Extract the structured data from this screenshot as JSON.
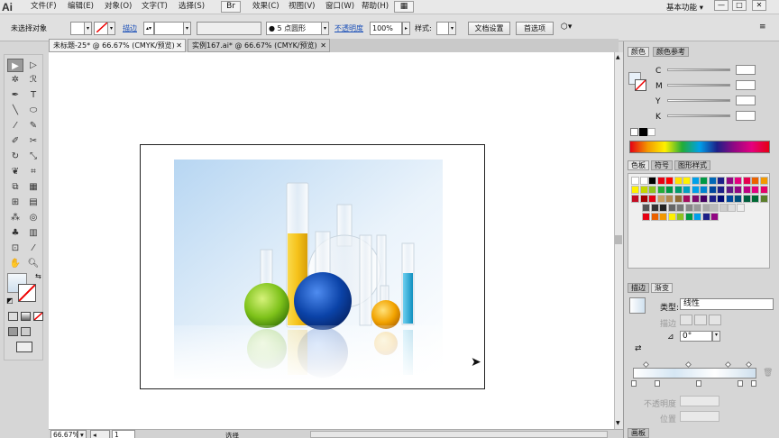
{
  "app": {
    "logo": "Ai"
  },
  "menubar": {
    "items": [
      "文件(F)",
      "编辑(E)",
      "对象(O)",
      "文字(T)",
      "选择(S)",
      "效果(C)",
      "视图(V)",
      "窗口(W)",
      "帮助(H)"
    ],
    "bridge_label": "Br",
    "workspace": "基本功能 ▾",
    "win_minimize": "—",
    "win_maximize": "□",
    "win_close": "✕"
  },
  "control": {
    "no_selection": "未选择对象",
    "stroke_label": "描边",
    "brush_value": "● 5 点圆形",
    "opacity_label": "不透明度",
    "opacity_value": "100%",
    "style_label": "样式:",
    "doc_setup_button": "文档设置",
    "preferences_button": "首选项"
  },
  "tabs": [
    {
      "label": "未标题-25* @ 66.67% (CMYK/预览)",
      "close": "✕",
      "active": true
    },
    {
      "label": "实例167.ai* @ 66.67% (CMYK/预览)",
      "close": "✕",
      "active": false
    }
  ],
  "status": {
    "zoom": "66.67%",
    "page": "1",
    "mode": "选择"
  },
  "panels": {
    "color": {
      "tab_color": "颜色",
      "tab_color_guide": "颜色参考",
      "channels": [
        "C",
        "M",
        "Y",
        "K"
      ]
    },
    "swatches": {
      "tab_swatches": "色板",
      "tab_symbols": "符号",
      "tab_graphic_styles": "图形样式",
      "colors_row1": [
        "#ffffff",
        "#ffffff",
        "#000000",
        "#e60012",
        "#ff0000",
        "#ffe100",
        "#fff100",
        "#00a0e9",
        "#009944",
        "#0068b7",
        "#1d2088",
        "#920783",
        "#e4007f",
        "#e5004f",
        "#eb6100",
        "#f39800"
      ],
      "colors_row2": [
        "#fff100",
        "#c3d600",
        "#8fc31f",
        "#22ac38",
        "#009944",
        "#009b6b",
        "#00a0c1",
        "#00a0e9",
        "#0086d1",
        "#00479d",
        "#1d2088",
        "#601986",
        "#920783",
        "#be0081",
        "#e4007f",
        "#e5006a"
      ],
      "colors_row3": [
        "#c30d23",
        "#a40000",
        "#e60012",
        "#c9a063",
        "#b28850",
        "#8f6a34",
        "#a40b5d",
        "#7e0c6e",
        "#440062",
        "#1d2088",
        "#000b76",
        "#00479d",
        "#004e7a",
        "#005e3c",
        "#006934",
        "#5b7e2b"
      ],
      "colors_row4": [
        "#555555",
        "#333333",
        "#222222",
        "#666666",
        "#777777",
        "#888888",
        "#999999",
        "#aaaaaa",
        "#bbbbbb",
        "#cccccc",
        "#dddddd",
        "#eeeeee"
      ],
      "colors_row5": [
        "#e60012",
        "#eb6100",
        "#f39800",
        "#fff100",
        "#8fc31f",
        "#009944",
        "#00a0e9",
        "#1d2088",
        "#920783"
      ]
    },
    "gradient": {
      "tab_stroke": "描边",
      "tab_gradient": "渐变",
      "type_label": "类型:",
      "type_value": "线性",
      "stroke_label": "描边",
      "angle_value": "0°",
      "opacity_label": "不透明度",
      "position_label": "位置"
    },
    "bottom_tab": "画板"
  },
  "illustration": {
    "accent_colors": {
      "yellow": "#f5c21a",
      "green": "#7ec21a",
      "blue": "#0b43a8",
      "orange": "#f2a300",
      "cyan": "#1aa5d6"
    }
  }
}
